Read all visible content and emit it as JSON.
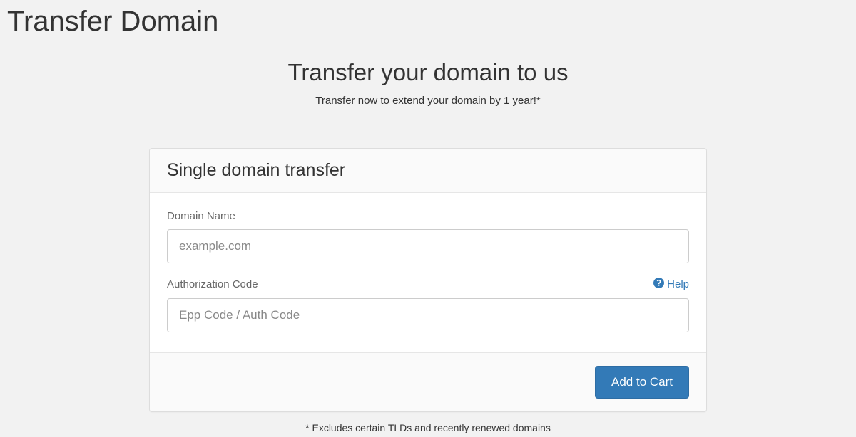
{
  "page": {
    "title": "Transfer Domain"
  },
  "hero": {
    "title": "Transfer your domain to us",
    "subtitle": "Transfer now to extend your domain by 1 year!*"
  },
  "card": {
    "header": "Single domain transfer",
    "domain": {
      "label": "Domain Name",
      "placeholder": "example.com",
      "value": ""
    },
    "auth": {
      "label": "Authorization Code",
      "placeholder": "Epp Code / Auth Code",
      "value": ""
    },
    "help": {
      "label": "Help"
    },
    "submit": {
      "label": "Add to Cart"
    }
  },
  "footnote": "* Excludes certain TLDs and recently renewed domains"
}
